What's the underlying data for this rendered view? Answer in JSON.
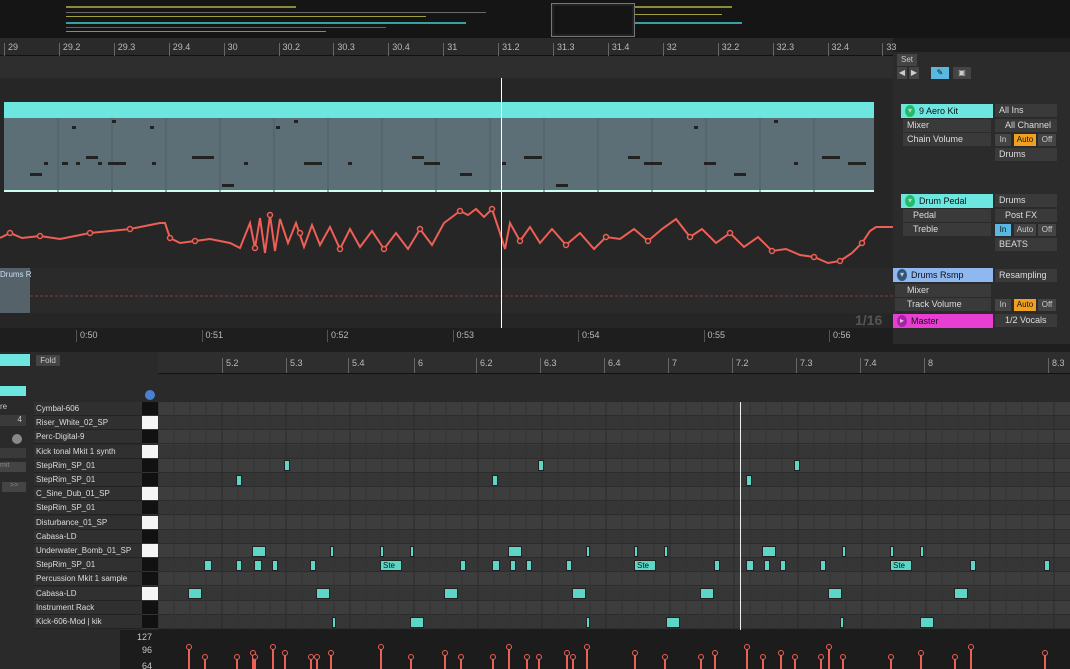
{
  "arrangement": {
    "bars": [
      "29",
      "29.2",
      "29.3",
      "29.4",
      "30",
      "30.2",
      "30.3",
      "30.4",
      "31",
      "31.2",
      "31.3",
      "31.4",
      "32",
      "32.2",
      "32.3",
      "32.4",
      "33"
    ],
    "times": [
      "0:50",
      "0:51",
      "0:52",
      "0:53",
      "0:54",
      "0:55",
      "0:56"
    ],
    "quantize": "1/16",
    "drums_r_label": "Drums R"
  },
  "mixer": {
    "set_label": "Set",
    "track1": {
      "name": "9 Aero Kit",
      "device": "Mixer",
      "param": "Chain Volume",
      "input": "All Ins",
      "channel": "All Channel",
      "monitor": [
        "In",
        "Auto",
        "Off"
      ],
      "output": "Drums"
    },
    "track2": {
      "name": "Drum Pedal",
      "device": "Pedal",
      "param": "Treble",
      "output": "Drums",
      "send": "Post FX",
      "monitor": [
        "In",
        "Auto",
        "Off"
      ],
      "group": "BEATS"
    },
    "track3": {
      "name": "Drums Rsmp",
      "device": "Mixer",
      "param": "Track Volume",
      "input": "Resampling",
      "monitor": [
        "In",
        "Auto",
        "Off"
      ]
    },
    "master": {
      "name": "Master",
      "output": "1/2 Vocals"
    }
  },
  "piano_roll": {
    "fold_label": "Fold",
    "ticks": [
      "5.2",
      "5.3",
      "5.4",
      "6",
      "6.2",
      "6.3",
      "6.4",
      "7",
      "7.2",
      "7.3",
      "7.4",
      "8",
      "8.3"
    ],
    "left_values": {
      "grid": "4",
      "commit": "mit",
      "expand": ">>"
    },
    "left_partial": "re",
    "lanes": [
      "Cymbal-606",
      "Riser_White_02_SP",
      "Perc-Digital-9",
      "Kick tonal Mkit 1 synth",
      "StepRim_SP_01",
      "StepRim_SP_01",
      "C_Sine_Dub_01_SP",
      "StepRim_SP_01",
      "Disturbance_01_SP",
      "Cabasa-LD",
      "Underwater_Bomb_01_SP",
      "StepRim_SP_01",
      "Percussion Mkit 1 sample",
      "Cabasa-LD",
      "Instrument Rack",
      "Kick-606-Mod | kik"
    ],
    "note_label": "Ste",
    "velocity_labels": [
      "127",
      "96",
      "64"
    ]
  },
  "colors": {
    "accent": "#6de6e0",
    "automation": "#ee5f55",
    "master": "#e83fd3",
    "note": "#5ed6c6"
  }
}
